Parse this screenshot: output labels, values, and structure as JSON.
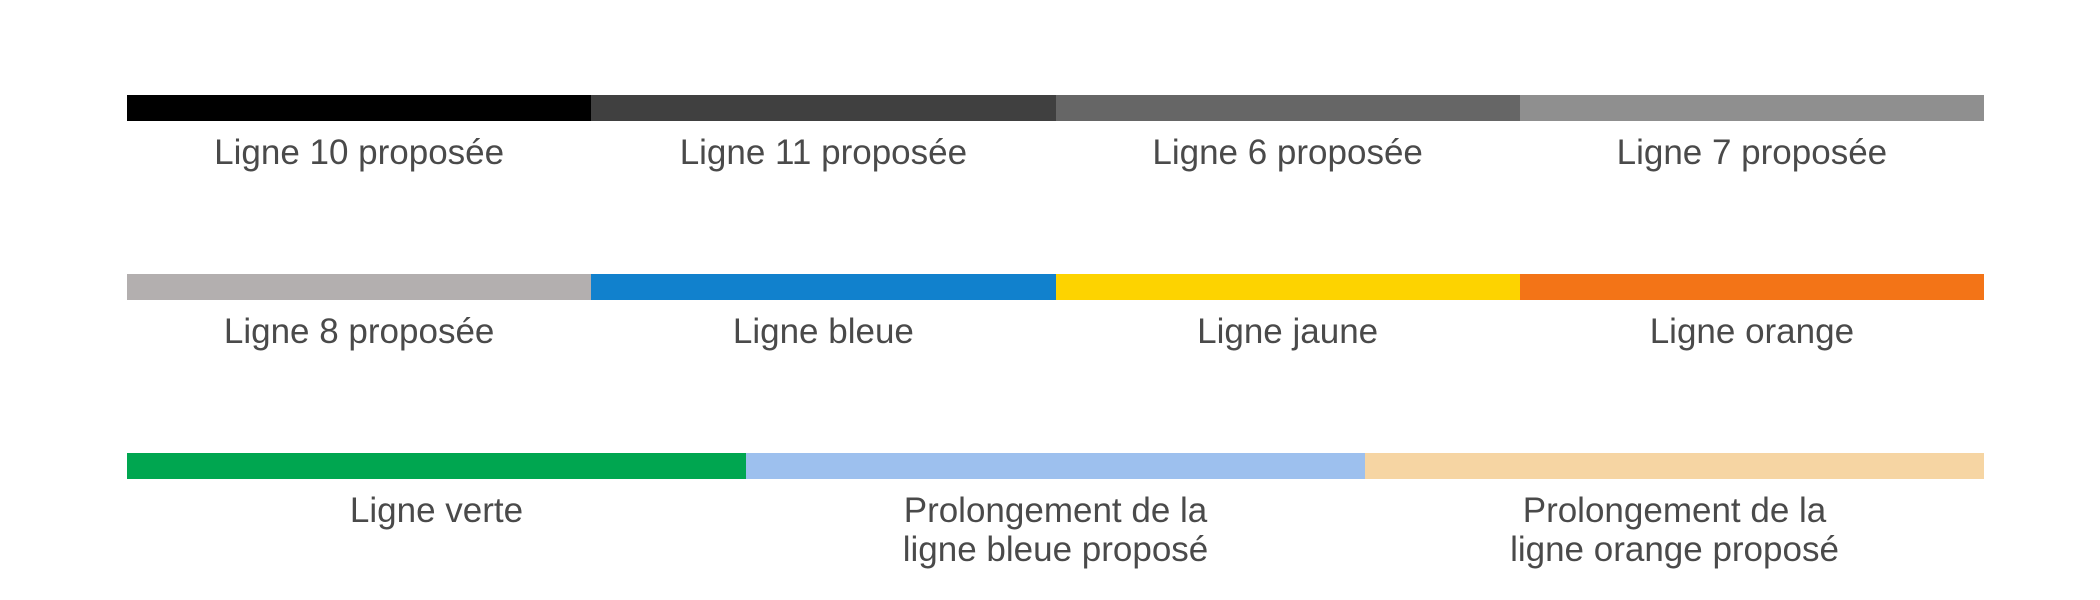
{
  "legend": {
    "rows": [
      {
        "entries": [
          {
            "label": "Ligne 10 proposée",
            "color": "#000000"
          },
          {
            "label": "Ligne 11 proposée",
            "color": "#404040"
          },
          {
            "label": "Ligne 6 proposée",
            "color": "#666666"
          },
          {
            "label": "Ligne 7 proposée",
            "color": "#8f8f8f"
          }
        ]
      },
      {
        "entries": [
          {
            "label": "Ligne 8 proposée",
            "color": "#b3afaf"
          },
          {
            "label": "Ligne bleue",
            "color": "#1181cd"
          },
          {
            "label": "Ligne jaune",
            "color": "#fdd300"
          },
          {
            "label": "Ligne orange",
            "color": "#f37417"
          }
        ]
      },
      {
        "entries": [
          {
            "label": "Ligne verte",
            "color": "#00a650"
          },
          {
            "label": "Prolongement de la\nligne bleue proposé",
            "color": "#9dc0ee"
          },
          {
            "label": "Prolongement de la\nligne orange proposé",
            "color": "#f6d5a3"
          }
        ]
      }
    ]
  }
}
